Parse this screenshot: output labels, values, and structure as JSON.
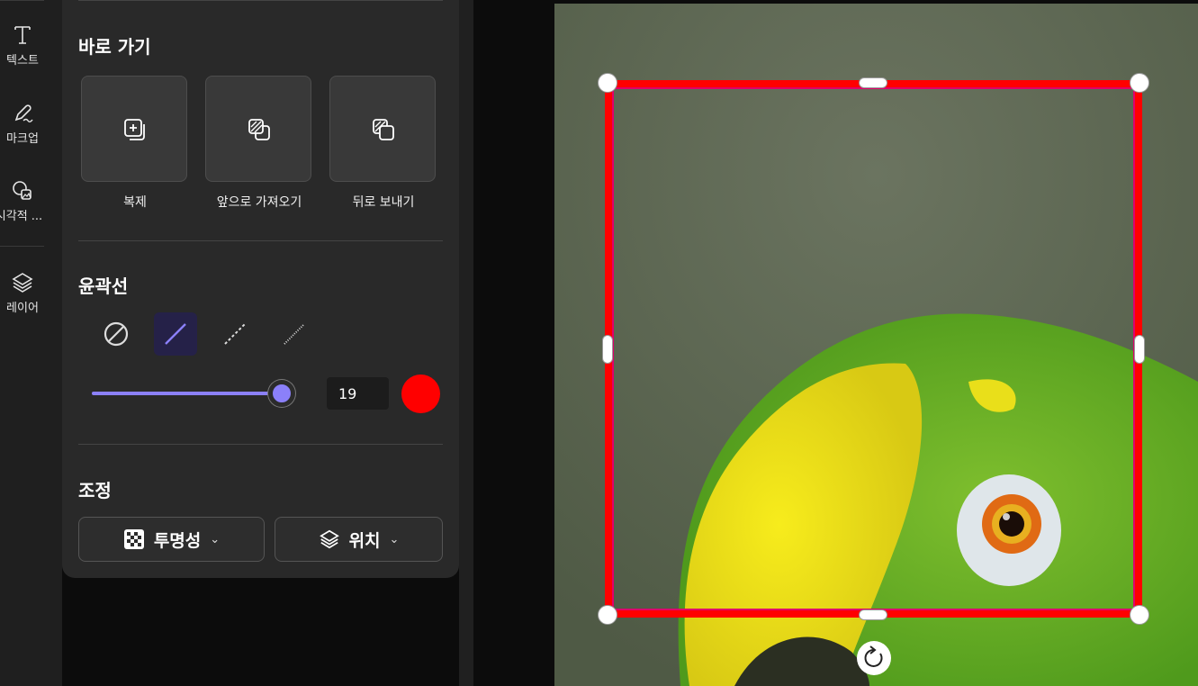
{
  "rail": {
    "items": [
      {
        "label": "텍스트",
        "icon": "text-icon"
      },
      {
        "label": "마크업",
        "icon": "pen-icon"
      },
      {
        "label": "시각적 ...",
        "icon": "visual-icon"
      },
      {
        "label": "레이어",
        "icon": "layers-icon"
      }
    ]
  },
  "quick": {
    "title": "바로 가기",
    "buttons": [
      {
        "label": "복제",
        "icon": "duplicate-icon"
      },
      {
        "label": "앞으로 가져오기",
        "icon": "bring-forward-icon"
      },
      {
        "label": "뒤로 보내기",
        "icon": "send-backward-icon"
      }
    ]
  },
  "outline": {
    "title": "윤곽선",
    "styles": [
      "none-icon",
      "solid-line-icon",
      "dashed-line-icon",
      "dotted-line-icon"
    ],
    "selected_style": "solid-line-icon",
    "width_value": "19",
    "slider_fraction": 1.0,
    "color": "#ff0000",
    "accent": "#8b80f9"
  },
  "adjust": {
    "title": "조정",
    "opacity_label": "투명성",
    "position_label": "위치"
  }
}
